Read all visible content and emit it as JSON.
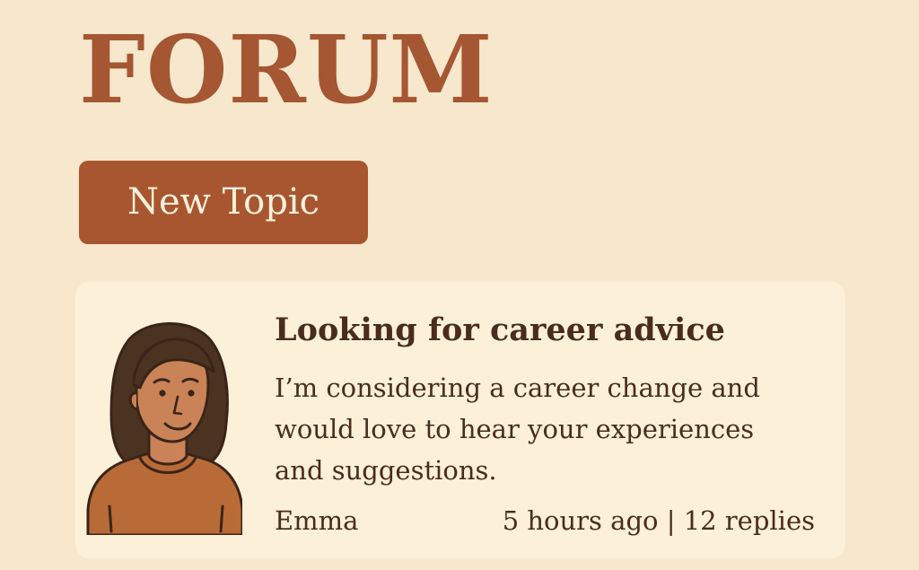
{
  "header": {
    "title": "FORUM"
  },
  "toolbar": {
    "new_topic_label": "New Topic"
  },
  "posts": [
    {
      "title": "Looking for career advice",
      "body": "I’m considering a career change and would love to hear your experiences and suggestions.",
      "author": "Emma",
      "time": "5 hours ago",
      "separator": "|",
      "replies": "12 replies",
      "avatar_icon": "woman-avatar-icon"
    }
  ],
  "colors": {
    "background": "#f6e7cd",
    "accent": "#a8562f",
    "card": "#fcf0d9",
    "text": "#4a2c1e"
  }
}
